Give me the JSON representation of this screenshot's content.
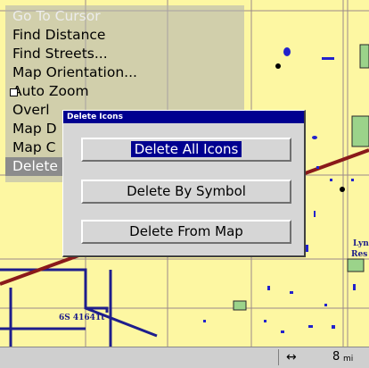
{
  "menu": {
    "items": [
      {
        "label": "Go To Cursor",
        "state": "dim"
      },
      {
        "label": "Find Distance",
        "state": "normal"
      },
      {
        "label": "Find Streets...",
        "state": "normal"
      },
      {
        "label": "Map Orientation...",
        "state": "normal"
      },
      {
        "label": "Auto Zoom",
        "state": "normal",
        "checkbox": true
      },
      {
        "label": "Overl",
        "state": "normal"
      },
      {
        "label": "Map D",
        "state": "normal"
      },
      {
        "label": "Map C",
        "state": "normal"
      },
      {
        "label": "Delete",
        "state": "selected"
      }
    ]
  },
  "dialog": {
    "title": "Delete Icons",
    "buttons": [
      {
        "label": "Delete All Icons",
        "focused": true
      },
      {
        "label": "Delete By Symbol",
        "focused": false
      },
      {
        "label": "Delete From Map",
        "focused": false
      }
    ]
  },
  "map": {
    "labels": {
      "road": "6S 41641t",
      "place": "Lyn",
      "place2": "Res"
    },
    "colors": {
      "land": "#fdf7a2",
      "road_major": "#8a1a1a",
      "road_minor": "#1e1e8c",
      "water": "#2222cc",
      "park": "#9bd38a"
    }
  },
  "status": {
    "arrow": "↔",
    "distance": "8",
    "unit": "mi"
  }
}
